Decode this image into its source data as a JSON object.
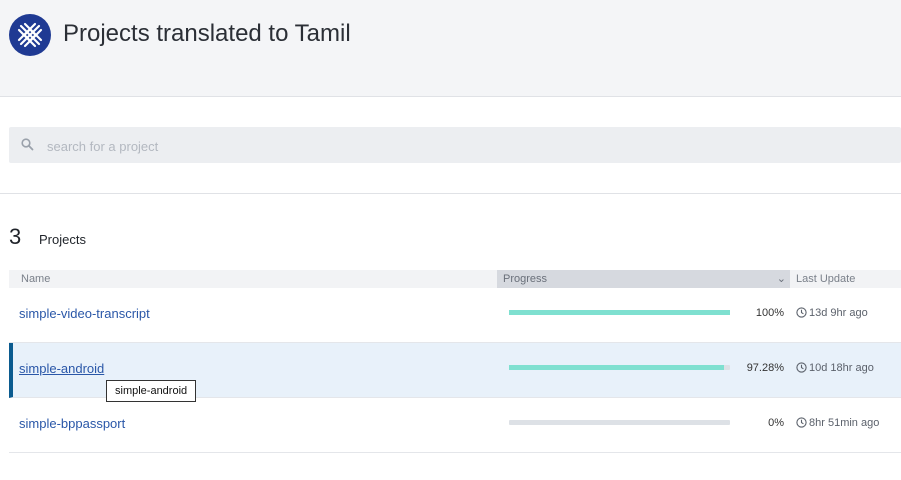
{
  "header": {
    "title": "Projects translated to Tamil",
    "brand_color": "#1f3a93"
  },
  "search": {
    "placeholder": "search for a project",
    "value": ""
  },
  "summary": {
    "count": "3",
    "label": "Projects"
  },
  "table": {
    "columns": {
      "name": "Name",
      "progress": "Progress",
      "last_update": "Last Update"
    },
    "rows": [
      {
        "name": "simple-video-transcript",
        "progress_pct": 100,
        "progress_label": "100%",
        "last_update": "13d 9hr ago"
      },
      {
        "name": "simple-android",
        "progress_pct": 97.28,
        "progress_label": "97.28%",
        "last_update": "10d 18hr ago"
      },
      {
        "name": "simple-bppassport",
        "progress_pct": 0,
        "progress_label": "0%",
        "last_update": "8hr 51min ago"
      }
    ]
  },
  "tooltip": {
    "text": "simple-android"
  },
  "colors": {
    "progress_fill": "#7fe0d0",
    "link": "#2a57a8",
    "active_row": "#e8f1fa"
  }
}
